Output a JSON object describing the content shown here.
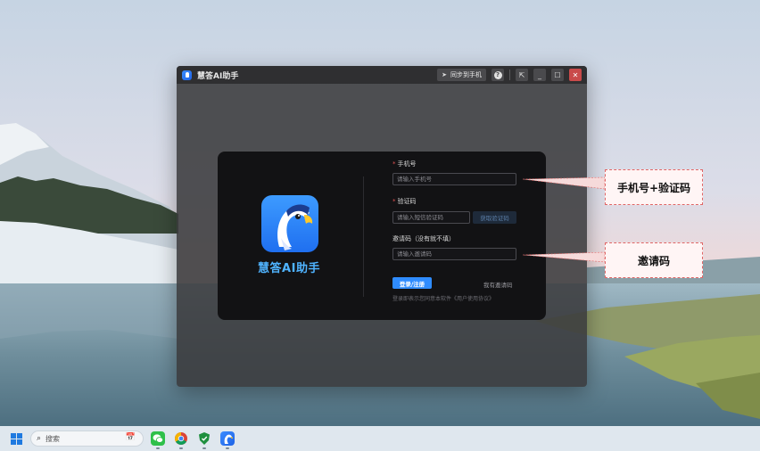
{
  "window": {
    "title": "慧答AI助手",
    "sync_label": "同步到手机",
    "help_glyph": "?",
    "restore_glyph": "⇱",
    "minimize_glyph": "_",
    "maximize_glyph": "☐",
    "close_glyph": "✕"
  },
  "login": {
    "app_name": "慧答AI助手",
    "phone": {
      "required_mark": "*",
      "label": "手机号",
      "placeholder": "请输入手机号"
    },
    "code": {
      "required_mark": "*",
      "label": "验证码",
      "placeholder": "请输入短信验证码",
      "button": "获取验证码"
    },
    "invite": {
      "label": "邀请码（没有就不填）",
      "placeholder": "请输入邀请码"
    },
    "submit": "登录/注册",
    "have_invite": "我有邀请码",
    "agreement": "登录即表示您同意本软件《用户使用协议》"
  },
  "callouts": {
    "phone_code": "手机号+验证码",
    "invite": "邀请码"
  },
  "taskbar": {
    "search_placeholder": "搜索",
    "apps": [
      "wechat-icon",
      "chrome-icon",
      "shield-icon",
      "huida-icon"
    ]
  },
  "colors": {
    "accent": "#2f8cff",
    "brand_text": "#4fb3ff",
    "close": "#c94a4a",
    "callout_border": "#e06666"
  }
}
